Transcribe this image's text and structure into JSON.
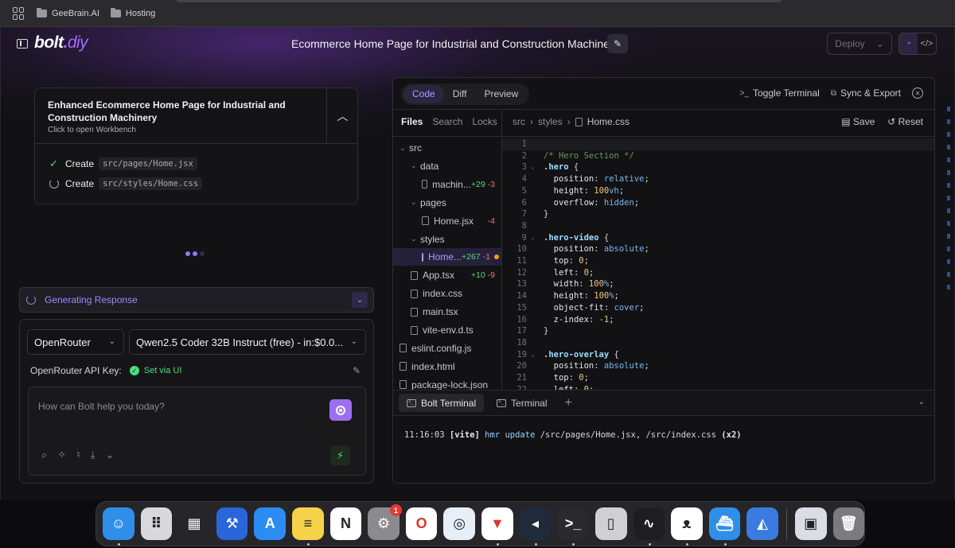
{
  "browser": {
    "bookmarks": [
      {
        "label": "GeeBrain.AI",
        "icon": "folder-icon"
      },
      {
        "label": "Hosting",
        "icon": "folder-icon"
      }
    ]
  },
  "app": {
    "logo_main": "bolt",
    "logo_dot": ".",
    "logo_suffix": "diy",
    "project_title": "Ecommerce Home Page for Industrial and Construction Machinery",
    "deploy_label": "Deploy",
    "accent_color": "#a66bff"
  },
  "artifact": {
    "title": "Enhanced Ecommerce Home Page for Industrial and Construction Machinery",
    "subtitle": "Click to open Workbench",
    "actions": [
      {
        "verb": "Create",
        "path": "src/pages/Home.jsx",
        "status": "done"
      },
      {
        "verb": "Create",
        "path": "src/styles/Home.css",
        "status": "in-progress"
      }
    ]
  },
  "chat": {
    "generating_label": "Generating Response",
    "provider": "OpenRouter",
    "model": "Qwen2.5 Coder 32B Instruct (free) - in:$0.0...",
    "api_key_label": "OpenRouter API Key:",
    "api_key_status": "Set via UI",
    "prompt_placeholder": "How can Bolt help you today?"
  },
  "workbench": {
    "view_tabs": [
      "Code",
      "Diff",
      "Preview"
    ],
    "active_view": "Code",
    "toggle_terminal": "Toggle Terminal",
    "sync_export": "Sync & Export",
    "file_tabs": [
      "Files",
      "Search",
      "Locks"
    ],
    "breadcrumb": [
      "src",
      "styles",
      "Home.css"
    ],
    "save_label": "Save",
    "reset_label": "Reset",
    "tree": [
      {
        "name": "src",
        "type": "folder",
        "depth": 0
      },
      {
        "name": "data",
        "type": "folder",
        "depth": 1
      },
      {
        "name": "machin...",
        "type": "file",
        "depth": 2,
        "add": "+29",
        "del": "-3"
      },
      {
        "name": "pages",
        "type": "folder",
        "depth": 1
      },
      {
        "name": "Home.jsx",
        "type": "file",
        "depth": 2,
        "add": "",
        "del": "-4"
      },
      {
        "name": "styles",
        "type": "folder",
        "depth": 1
      },
      {
        "name": "Home...",
        "type": "file",
        "depth": 2,
        "add": "+267",
        "del": "-1",
        "modified": true,
        "selected": true
      },
      {
        "name": "App.tsx",
        "type": "file",
        "depth": 1,
        "add": "+10",
        "del": "-9"
      },
      {
        "name": "index.css",
        "type": "file",
        "depth": 1
      },
      {
        "name": "main.tsx",
        "type": "file",
        "depth": 1
      },
      {
        "name": "vite-env.d.ts",
        "type": "file",
        "depth": 1
      },
      {
        "name": "eslint.config.js",
        "type": "file",
        "depth": 0
      },
      {
        "name": "index.html",
        "type": "file",
        "depth": 0
      },
      {
        "name": "package-lock.json",
        "type": "file",
        "depth": 0
      }
    ],
    "code_lines": [
      "",
      "/* Hero Section */",
      ".hero {",
      "  position: relative;",
      "  height: 100vh;",
      "  overflow: hidden;",
      "}",
      "",
      ".hero-video {",
      "  position: absolute;",
      "  top: 0;",
      "  left: 0;",
      "  width: 100%;",
      "  height: 100%;",
      "  object-fit: cover;",
      "  z-index: -1;",
      "}",
      "",
      ".hero-overlay {",
      "  position: absolute;",
      "  top: 0;",
      "  left: 0;"
    ],
    "terminal_tabs": [
      "Bolt Terminal",
      "Terminal"
    ],
    "terminal_output": {
      "time": "11:16:03",
      "tag": "[vite]",
      "message": "hmr update",
      "paths": "/src/pages/Home.jsx, /src/index.css",
      "count": "(x2)"
    }
  },
  "dock": {
    "apps": [
      {
        "name": "Finder",
        "icon": "finder-icon",
        "color": "#2f8fe8",
        "running": true
      },
      {
        "name": "Launchpad",
        "icon": "launchpad-icon",
        "color": "#d9d9dd",
        "running": false
      },
      {
        "name": "Mission Control",
        "icon": "mission-control-icon",
        "color": "#26262a",
        "running": false
      },
      {
        "name": "Xcode",
        "icon": "xcode-icon",
        "color": "#2a66d9",
        "running": false
      },
      {
        "name": "App Store",
        "icon": "app-store-icon",
        "color": "#2b8cf3",
        "running": false
      },
      {
        "name": "Notes",
        "icon": "notes-icon",
        "color": "#f5d24a",
        "running": true
      },
      {
        "name": "Notion",
        "icon": "notion-icon",
        "color": "#ffffff",
        "running": false
      },
      {
        "name": "System Settings",
        "icon": "settings-icon",
        "color": "#8a8a90",
        "running": false,
        "badge": "1"
      },
      {
        "name": "Opera",
        "icon": "opera-icon",
        "color": "#ffffff",
        "running": false
      },
      {
        "name": "Safari",
        "icon": "safari-icon",
        "color": "#e8eef8",
        "running": false
      },
      {
        "name": "Brave",
        "icon": "brave-icon",
        "color": "#ffffff",
        "running": true
      },
      {
        "name": "VS Code",
        "icon": "vscode-icon",
        "color": "#1f2a3a",
        "running": true
      },
      {
        "name": "Terminal",
        "icon": "terminal-icon",
        "color": "#2a2a2e",
        "running": true
      },
      {
        "name": "iPhone Mirroring",
        "icon": "iphone-icon",
        "color": "#d0d0d4",
        "running": false
      },
      {
        "name": "Activity Monitor",
        "icon": "activity-monitor-icon",
        "color": "#1e1e20",
        "running": true
      },
      {
        "name": "Ollama",
        "icon": "ollama-icon",
        "color": "#ffffff",
        "running": true
      },
      {
        "name": "Docker",
        "icon": "docker-icon",
        "color": "#2f8fe8",
        "running": true
      },
      {
        "name": "Xcode Instruments",
        "icon": "instruments-icon",
        "color": "#3a7be0",
        "running": false
      }
    ],
    "extras": [
      {
        "name": "Preview",
        "icon": "preview-icon",
        "color": "#d8dde6"
      },
      {
        "name": "Trash",
        "icon": "trash-icon",
        "color": "#7a7a80"
      }
    ]
  }
}
